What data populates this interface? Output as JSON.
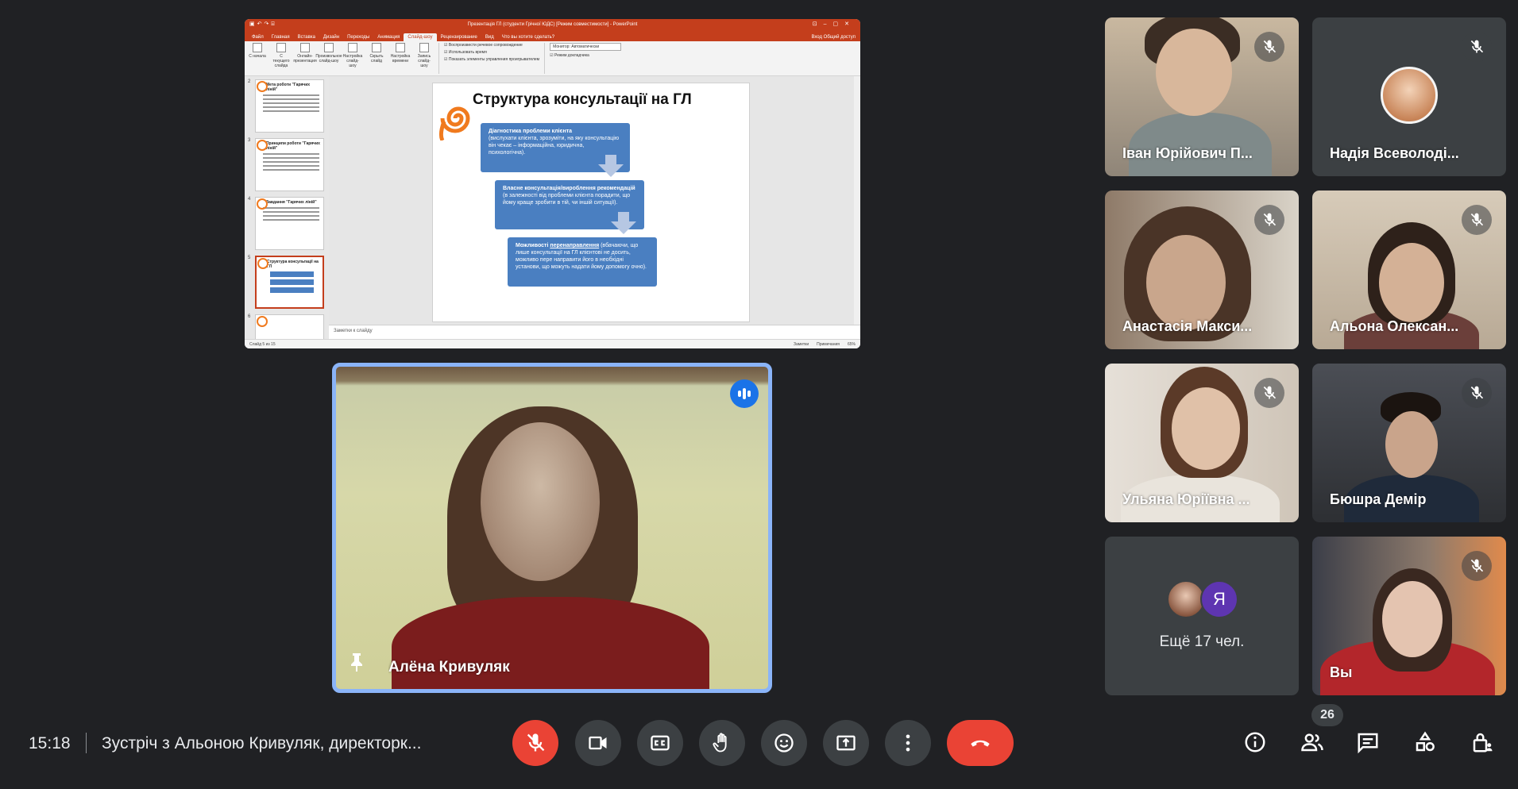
{
  "presentation": {
    "window_title": "Презентація ГЛ (студенти Грічної ЮДС) [Режим совместимости] - PowerPoint",
    "ribbon_tabs": [
      "Файл",
      "Главная",
      "Вставка",
      "Дизайн",
      "Переходы",
      "Анимация",
      "Слайд-шоу",
      "Рецензирование",
      "Вид",
      "Что вы хотите сделать?"
    ],
    "active_tab_index": 6,
    "ribbon_right": "Вход  Общий доступ",
    "ribbon_buttons": [
      "С начала",
      "С текущего слайда",
      "Онлайн-презентация",
      "Произвольное слайд-шоу",
      "Настройка слайд-шоу",
      "Скрыть слайд",
      "Настройка времени",
      "Запись слайд-шоу"
    ],
    "ribbon_checks": [
      "Воспроизвести речевое сопровождение",
      "Использовать время",
      "Показать элементы управления проигрывателем"
    ],
    "monitor_label": "Монитор:",
    "monitor_value": "Автоматически",
    "presenter_mode": "Режим докладчика",
    "thumbnails": [
      {
        "num": "2",
        "title": "Мета роботи \"Гарячих ліній\""
      },
      {
        "num": "3",
        "title": "Принципи роботи \"Гарячих ліній\""
      },
      {
        "num": "4",
        "title": "Завдання \"Гарячих ліній\""
      },
      {
        "num": "5",
        "title": "Структура консультації на ГЛ"
      },
      {
        "num": "6",
        "title": ""
      }
    ],
    "slide": {
      "title": "Структура консультації на ГЛ",
      "box1_bold": "Діагностика проблеми клієнта",
      "box1_text": "(вислухати клієнта, зрозуміти, на яку консультацію він чекає – інформаційна, юридична, психологічна).",
      "box2_bold": "Власне консультація/вироблення рекомендацій",
      "box2_text": "(в залежності від проблеми клієнта порадити, що йому краще зробити в тій, чи іншій ситуації).",
      "box3_pre": "Можливості ",
      "box3_bold": "перенаправлення",
      "box3_text": " (вбачаючи, що лише консультації на ГЛ клієнтові не досить, можливо пере направити його в необхідні установи, що можуть надати йому допомогу очно)."
    },
    "notes_placeholder": "Заметки к слайду",
    "status_left": "Слайд 5 из 15",
    "status_right": [
      "Заметки",
      "Примечания",
      "65%"
    ]
  },
  "speaker": {
    "name": "Алёна Кривуляк",
    "pinned_icon": "pin-icon",
    "speaking_icon": "speaking-indicator-icon"
  },
  "participants": [
    {
      "name": "Іван Юрійович П...",
      "muted": true
    },
    {
      "name": "Надія Всеволоді...",
      "muted": true
    },
    {
      "name": "Анастасія Макси...",
      "muted": true
    },
    {
      "name": "Альона Олексан...",
      "muted": true
    },
    {
      "name": "Ульяна Юріївна ...",
      "muted": true
    },
    {
      "name": "Бюшра Демір",
      "muted": true
    },
    {
      "name": "Вы",
      "muted": true
    }
  ],
  "more_tile": {
    "letter": "Я",
    "label": "Ещё 17 чел."
  },
  "bottom_bar": {
    "time": "15:18",
    "meeting_title": "Зустріч з Альоною Кривуляк, директорк...",
    "people_count": "26"
  },
  "colors": {
    "background": "#202124",
    "tile": "#3c4043",
    "danger": "#ea4335",
    "accent": "#8ab4f8",
    "speaking": "#1a73e8",
    "powerpoint": "#c43e1c",
    "slide_box": "#4a7fc1"
  }
}
